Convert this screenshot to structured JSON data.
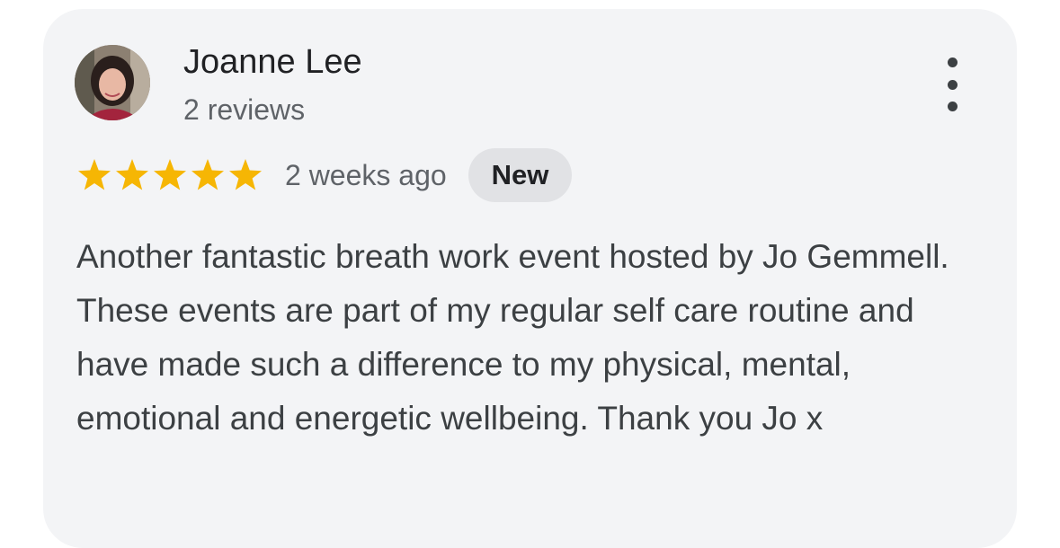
{
  "review": {
    "author": "Joanne Lee",
    "reviews_count": "2 reviews",
    "rating": 5,
    "rating_max": 5,
    "time_ago": "2 weeks ago",
    "badge": "New",
    "text": "Another fantastic breath work event hosted by Jo Gemmell. These events are part of my regular self care routine and have made such a difference to my physical, mental, emotional and energetic wellbeing. Thank you Jo x"
  },
  "icons": {
    "avatar": "avatar-photo",
    "star": "star-icon",
    "more": "more-vert-icon"
  },
  "colors": {
    "star": "#F6B604",
    "card_bg": "#F3F4F6",
    "badge_bg": "#E1E2E5"
  }
}
